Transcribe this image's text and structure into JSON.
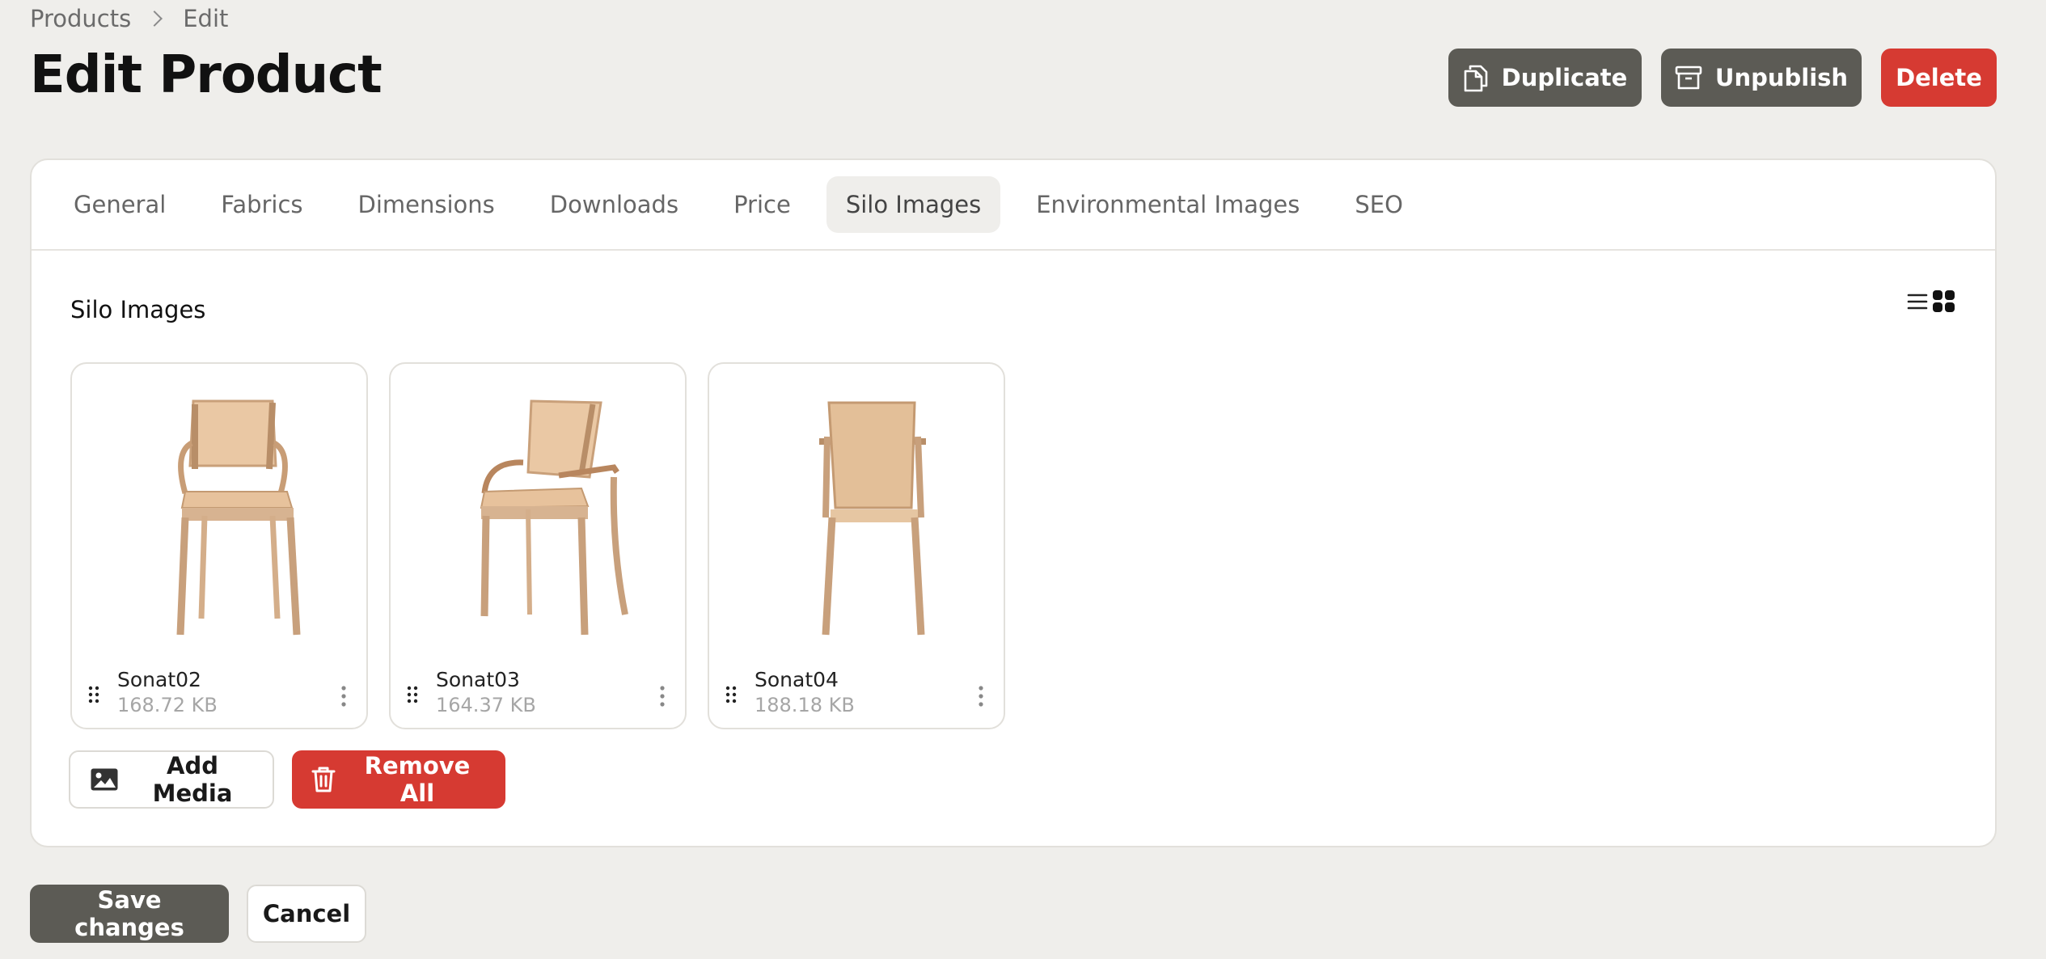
{
  "breadcrumb": {
    "items": [
      "Products",
      "Edit"
    ]
  },
  "page": {
    "title": "Edit Product"
  },
  "header_actions": {
    "duplicate": "Duplicate",
    "unpublish": "Unpublish",
    "delete": "Delete"
  },
  "tabs": [
    "General",
    "Fabrics",
    "Dimensions",
    "Downloads",
    "Price",
    "Silo Images",
    "Environmental Images",
    "SEO"
  ],
  "active_tab": "Silo Images",
  "section": {
    "title": "Silo Images"
  },
  "images": [
    {
      "name": "Sonat02",
      "size": "168.72 KB"
    },
    {
      "name": "Sonat03",
      "size": "164.37 KB"
    },
    {
      "name": "Sonat04",
      "size": "188.18 KB"
    }
  ],
  "card_actions": {
    "add_media": "Add Media",
    "remove_all": "Remove All"
  },
  "footer": {
    "save": "Save changes",
    "cancel": "Cancel"
  },
  "colors": {
    "background": "#efeeeb",
    "dark_button": "#5c5b55",
    "danger": "#d63a32"
  }
}
